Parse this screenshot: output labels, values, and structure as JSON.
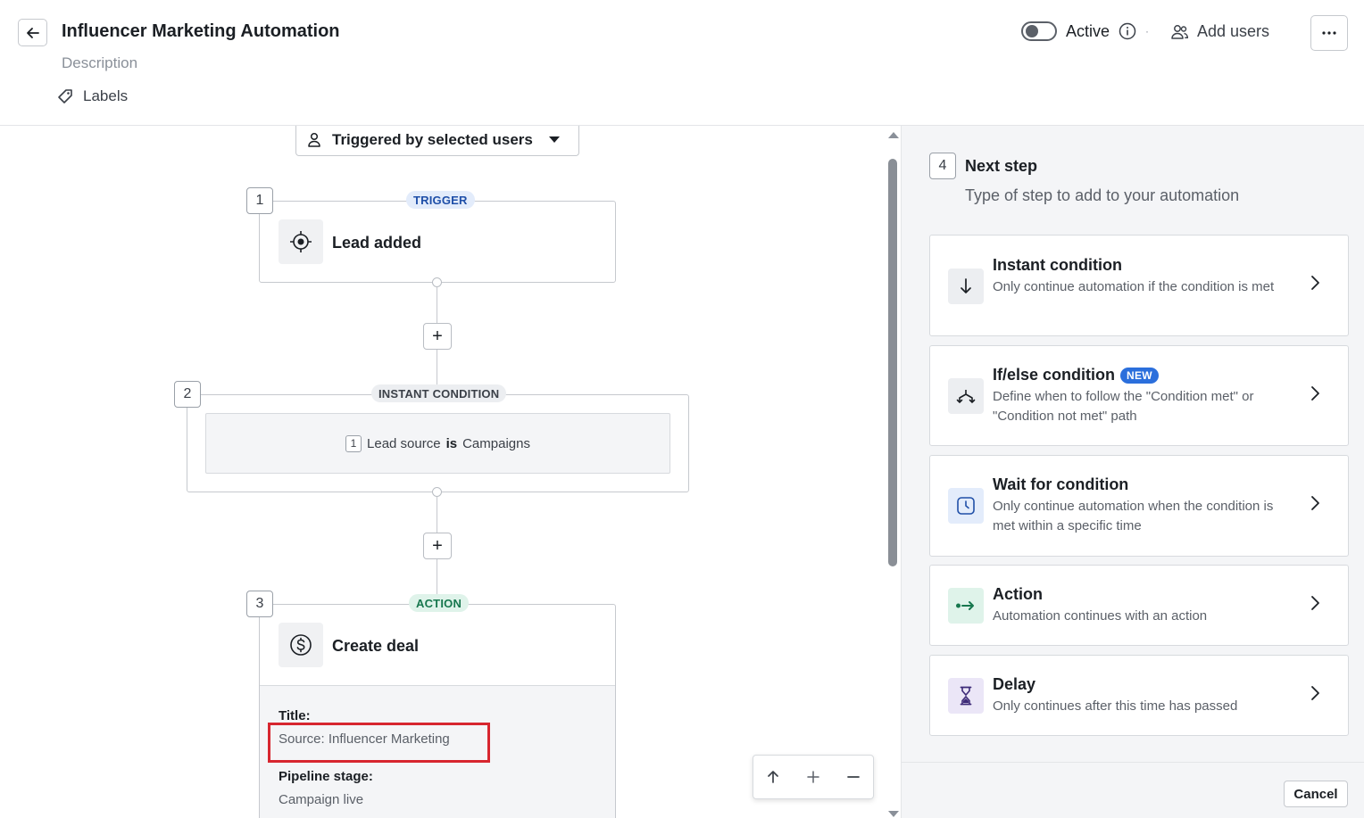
{
  "header": {
    "title": "Influencer Marketing Automation",
    "description": "Description",
    "labels": "Labels",
    "active_label": "Active",
    "add_users": "Add users"
  },
  "canvas": {
    "trigger_select": "Triggered by selected users",
    "steps": [
      {
        "number": "1",
        "tag": "TRIGGER",
        "title": "Lead added"
      },
      {
        "number": "2",
        "tag": "INSTANT CONDITION",
        "condition": {
          "index": "1",
          "field": "Lead source",
          "operator": "is",
          "value": "Campaigns"
        }
      },
      {
        "number": "3",
        "tag": "ACTION",
        "title": "Create deal",
        "details": {
          "title_label": "Title:",
          "title_value": "Source: Influencer Marketing",
          "stage_label": "Pipeline stage:",
          "stage_value": "Campaign live"
        }
      }
    ],
    "plus": "+"
  },
  "panel": {
    "step_number": "4",
    "title": "Next step",
    "subtitle": "Type of step to add to your automation",
    "options": [
      {
        "title": "Instant condition",
        "desc": "Only continue automation if the condition is met",
        "icon": "arrow-down-icon"
      },
      {
        "title": "If/else condition",
        "badge": "NEW",
        "desc": "Define when to follow the \"Condition met\" or \"Condition not met\" path",
        "icon": "branch-icon"
      },
      {
        "title": "Wait for condition",
        "desc": "Only continue automation when the condition is met within a specific time",
        "icon": "clock-icon"
      },
      {
        "title": "Action",
        "desc": "Automation continues with an action",
        "icon": "action-arrow-icon"
      },
      {
        "title": "Delay",
        "desc": "Only continues after this time has passed",
        "icon": "hourglass-icon"
      }
    ],
    "cancel": "Cancel"
  },
  "colors": {
    "highlight": "#d7262f",
    "new_badge": "#2b6fdc",
    "action_green": "#17774e",
    "trigger_blue": "#1f4fa8"
  }
}
